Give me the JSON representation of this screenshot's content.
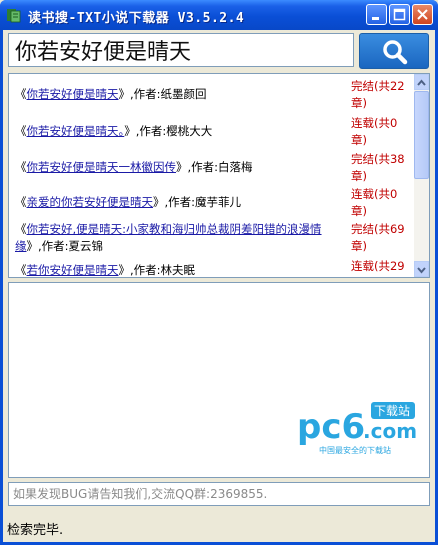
{
  "window": {
    "title": "读书搜-TXT小说下载器 V3.5.2.4",
    "minimize_icon": "minimize-icon",
    "maximize_icon": "maximize-icon",
    "close_icon": "close-icon"
  },
  "search": {
    "value": "你若安好便是晴天",
    "button_icon": "search-icon"
  },
  "results": [
    {
      "prefix": "《",
      "title": "你若安好便是晴天",
      "suffix": "》,作者:纸墨颜回",
      "status_line1": "完结(共22",
      "status_line2": "章)"
    },
    {
      "prefix": "《",
      "title": "你若安好便是晴天。",
      "suffix": "》,作者:樱桃大大",
      "status_line1": "连载(共0",
      "status_line2": "章)"
    },
    {
      "prefix": "《",
      "title": "你若安好便是晴天一林徽因传",
      "suffix": "》,作者:白落梅",
      "status_line1": "完结(共38",
      "status_line2": "章)"
    },
    {
      "prefix": "《",
      "title": "亲爱的你若安好便是晴天",
      "suffix": "》,作者:魔芋菲儿",
      "status_line1": "连载(共0",
      "status_line2": "章)"
    },
    {
      "prefix": "《",
      "title": "你若安好,便是晴天:小家教和海归帅总裁阴差阳错的浪漫情缘",
      "suffix": "》,作者:夏云锦",
      "status_line1": "完结(共69",
      "status_line2": "章)"
    },
    {
      "prefix": "《",
      "title": "若你安好便是晴天",
      "suffix": "》,作者:林夫眠",
      "status_line1": "连载(共29",
      "status_line2": ""
    }
  ],
  "watermark": {
    "brand": "pc6",
    "domain": ".com",
    "badge": "下载站",
    "tagline": "中国最安全的下载站"
  },
  "notice": "如果发现BUG请告知我们,交流QQ群:2369855.",
  "status": "检索完毕."
}
